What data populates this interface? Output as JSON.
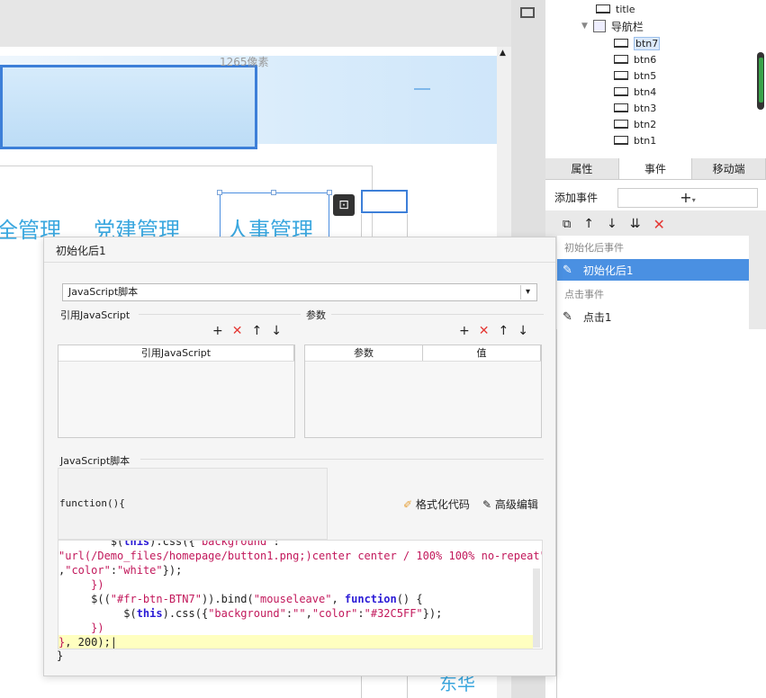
{
  "canvas": {
    "ruler_label": "1265像素",
    "nav_labels": [
      "全管理",
      "党建管理",
      "人事管理"
    ],
    "badge_text": "东华"
  },
  "tree": {
    "items": [
      {
        "label": "title",
        "selected": false
      },
      {
        "label": "导航栏",
        "selected": false
      },
      {
        "label": "btn7",
        "selected": true
      },
      {
        "label": "btn6",
        "selected": false
      },
      {
        "label": "btn5",
        "selected": false
      },
      {
        "label": "btn4",
        "selected": false
      },
      {
        "label": "btn3",
        "selected": false
      },
      {
        "label": "btn2",
        "selected": false
      },
      {
        "label": "btn1",
        "selected": false
      }
    ]
  },
  "props": {
    "tabs": [
      "属性",
      "事件",
      "移动端"
    ],
    "active_tab": "事件",
    "add_event_label": "添加事件",
    "add_event_button": "+",
    "groups": [
      {
        "label": "初始化后事件",
        "items": [
          "初始化后1"
        ]
      },
      {
        "label": "点击事件",
        "items": [
          "点击1"
        ]
      }
    ],
    "selected_event": "初始化后1"
  },
  "dialog": {
    "title": "初始化后1",
    "type_value": "JavaScript脚本",
    "ref_label": "引用JavaScript",
    "ref_header": "引用JavaScript",
    "param_label": "参数",
    "param_headers": [
      "参数",
      "值"
    ],
    "script_label": "JavaScript脚本",
    "fn_signature": "function(){",
    "format_label": "格式化代码",
    "advanced_label": "高级编辑",
    "closing_brace": "}"
  },
  "code": {
    "lines": [
      "        $(this).css({\"background\":",
      "\"url(/Demo_files/homepage/button1.png;)center center / 100% 100% no-repeat\"",
      ",\"color\":\"white\"});",
      "     })",
      "     $((\"#fr-btn-BTN7\")).bind(\"mouseleave\", function() {",
      "          $(this).css({\"background\":\"\",\"color\":\"#32C5FF\"});",
      "     })",
      "}, 200);"
    ]
  },
  "colors": {
    "accent": "#4a90e2",
    "nav_text": "#3aa7df",
    "delete_red": "#e53935",
    "highlight_line": "#ffffc0"
  }
}
